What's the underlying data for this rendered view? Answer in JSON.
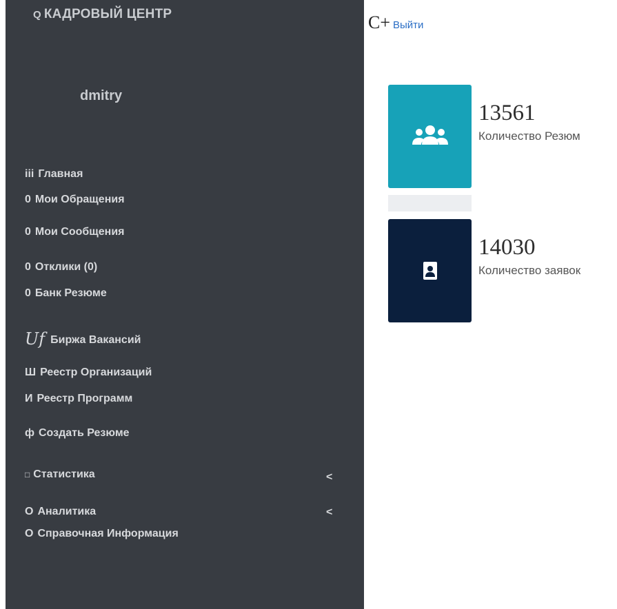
{
  "header": {
    "brand_icon": "Q",
    "brand_title": "КАДРОВЫЙ ЦЕНТР",
    "user_icon": "С+",
    "logout_label": "Выйти"
  },
  "sidebar": {
    "username": "dmitry",
    "items": [
      {
        "icon": "iii",
        "label": "Главная"
      },
      {
        "icon": "0",
        "label": "Мои Обращения"
      },
      {
        "icon": "0",
        "label": "Мои Сообщения"
      },
      {
        "icon": "0",
        "label": "Отклики (0)"
      },
      {
        "icon": "0",
        "label": "Банк Резюме"
      },
      {
        "icon": "Uf",
        "label": "Биржа Вакансий"
      },
      {
        "icon": "Ш",
        "label": "Реестр Организаций"
      },
      {
        "icon": "И",
        "label": "Реестр Программ"
      },
      {
        "icon": "ф",
        "label": "Создать Резюме"
      },
      {
        "icon": "□",
        "label": "Статистика",
        "chevron": "<"
      },
      {
        "icon": "О",
        "label": "Аналитика",
        "chevron": "<"
      },
      {
        "icon": "О",
        "label": "Справочная Информация"
      }
    ]
  },
  "stats": [
    {
      "value": "13561",
      "label": "Количество Резюм",
      "icon": "users-icon",
      "color": "#17a2b8"
    },
    {
      "value": "14030",
      "label": "Количество заявок",
      "icon": "contact-card-icon",
      "color": "#0b1f3d"
    }
  ]
}
